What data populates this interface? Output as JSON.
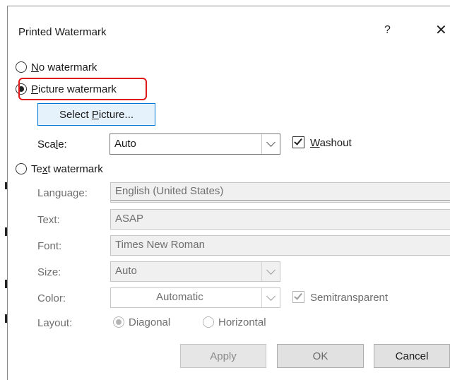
{
  "dialog": {
    "title": "Printed Watermark",
    "help_label": "?",
    "close_label": "✕"
  },
  "options": {
    "no_watermark": {
      "prefix": "",
      "accel": "N",
      "rest": "o watermark",
      "selected": false
    },
    "picture_watermark": {
      "prefix": "",
      "accel": "P",
      "rest": "icture watermark",
      "selected": true
    },
    "text_watermark": {
      "prefix": "Te",
      "accel": "x",
      "rest": "t watermark",
      "selected": false
    }
  },
  "picture": {
    "select_button": {
      "prefix": "Select ",
      "accel": "P",
      "rest": "icture..."
    },
    "scale_label": {
      "prefix": "Sca",
      "accel": "l",
      "rest": "e:"
    },
    "scale_value": "Auto",
    "washout": {
      "prefix": "",
      "accel": "W",
      "rest": "ashout",
      "checked": true
    }
  },
  "text": {
    "language_label": "Language:",
    "language_value": "English (United States)",
    "text_label": "Text:",
    "text_value": "ASAP",
    "font_label": "Font:",
    "font_value": "Times New Roman",
    "size_label": "Size:",
    "size_value": "Auto",
    "color_label": "Color:",
    "color_value": "Automatic",
    "semitransparent": {
      "label": "Semitransparent",
      "checked": true
    },
    "layout_label": "Layout:",
    "layout_diagonal": "Diagonal",
    "layout_horizontal": "Horizontal",
    "layout_selected": "Diagonal"
  },
  "buttons": {
    "apply": "Apply",
    "ok": "OK",
    "cancel": "Cancel"
  },
  "colors": {
    "highlight": "#e01a1a",
    "primary_border": "#0078d7",
    "primary_fill": "#e5f1fb",
    "disabled_text": "#6e6e6e"
  }
}
